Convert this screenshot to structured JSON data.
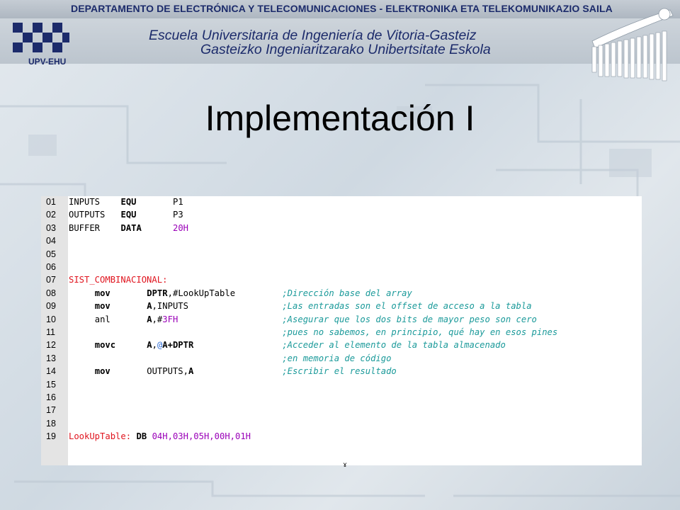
{
  "header": {
    "department": "DEPARTAMENTO DE ELECTRÓNICA Y TELECOMUNICACIONES - ELEKTRONIKA ETA TELEKOMUNIKAZIO SAILA",
    "school_line1": "Escuela Universitaria de Ingeniería de Vitoria-Gasteiz",
    "school_line2": "Gasteizko Ingeniaritzarako Unibertsitate Eskola",
    "logo_text": "UPV-EHU",
    "logo_icon": "upv-ehu-logo",
    "school_icon": "school-comb-logo"
  },
  "title": "Implementación I",
  "code": {
    "line_numbers": [
      "01",
      "02",
      "03",
      "04",
      "05",
      "06",
      "07",
      "08",
      "09",
      "10",
      "11",
      "12",
      "13",
      "14",
      "15",
      "16",
      "17",
      "18",
      "19"
    ],
    "lines": [
      [
        {
          "t": "INPUTS",
          "c": "black",
          "x": 0
        },
        {
          "t": "EQU",
          "c": "bold",
          "x": 10
        },
        {
          "t": "P1",
          "c": "black",
          "x": 20
        }
      ],
      [
        {
          "t": "OUTPUTS",
          "c": "black",
          "x": 0
        },
        {
          "t": "EQU",
          "c": "bold",
          "x": 10
        },
        {
          "t": "P3",
          "c": "black",
          "x": 20
        }
      ],
      [
        {
          "t": "BUFFER",
          "c": "black",
          "x": 0
        },
        {
          "t": "DATA",
          "c": "bold",
          "x": 10
        },
        {
          "t": "20H",
          "c": "num",
          "x": 20
        }
      ],
      [],
      [],
      [],
      [
        {
          "t": "SIST_COMBINACIONAL:",
          "c": "label",
          "x": 0
        }
      ],
      [
        {
          "t": "mov",
          "c": "bold",
          "x": 5
        },
        {
          "t": "DPTR",
          "c": "bold",
          "x": 15
        },
        {
          "t": ",#LookUpTable",
          "c": "black",
          "x": 19
        },
        {
          "t": ";Dirección base del array",
          "c": "cmt",
          "x": 41
        }
      ],
      [
        {
          "t": "mov",
          "c": "bold",
          "x": 5
        },
        {
          "t": "A",
          "c": "bold",
          "x": 15
        },
        {
          "t": ",INPUTS",
          "c": "black",
          "x": 16
        },
        {
          "t": ";Las entradas son el offset de acceso a la tabla",
          "c": "cmt",
          "x": 41
        }
      ],
      [
        {
          "t": "anl",
          "c": "black",
          "x": 5
        },
        {
          "t": "A",
          "c": "bold",
          "x": 15
        },
        {
          "t": ",#",
          "c": "black",
          "x": 16
        },
        {
          "t": "3FH",
          "c": "num",
          "x": 18
        },
        {
          "t": ";Asegurar que los dos bits de mayor peso son cero",
          "c": "cmt",
          "x": 41
        }
      ],
      [
        {
          "t": ";pues no sabemos, en principio, qué hay en esos pines",
          "c": "cmt",
          "x": 41
        }
      ],
      [
        {
          "t": "movc",
          "c": "bold",
          "x": 5
        },
        {
          "t": "A",
          "c": "bold",
          "x": 15
        },
        {
          "t": ",",
          "c": "black",
          "x": 16
        },
        {
          "t": "@",
          "c": "at",
          "x": 17
        },
        {
          "t": "A+DPTR",
          "c": "bold",
          "x": 18
        },
        {
          "t": ";Acceder al elemento de la tabla almacenado",
          "c": "cmt",
          "x": 41
        }
      ],
      [
        {
          "t": ";en memoria de código",
          "c": "cmt",
          "x": 41
        }
      ],
      [
        {
          "t": "mov",
          "c": "bold",
          "x": 5
        },
        {
          "t": "OUTPUTS,",
          "c": "black",
          "x": 15
        },
        {
          "t": "A",
          "c": "bold",
          "x": 23
        },
        {
          "t": ";Escribir el resultado",
          "c": "cmt",
          "x": 41
        }
      ],
      [],
      [],
      [],
      [],
      [
        {
          "t": "LookUpTable:",
          "c": "label",
          "x": 0
        },
        {
          "t": "DB",
          "c": "bold",
          "x": 13
        },
        {
          "t": "04H,03H,05H,00H,01H",
          "c": "num",
          "x": 16
        }
      ]
    ]
  }
}
